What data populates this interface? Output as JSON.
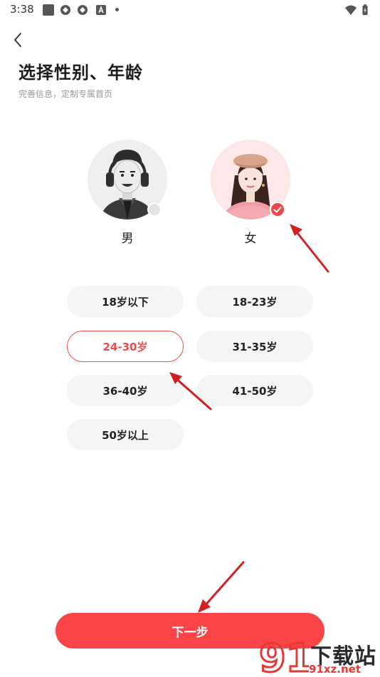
{
  "status_bar": {
    "time": "3:38"
  },
  "header": {
    "title": "选择性别、年龄",
    "subtitle": "完善信息，定制专属首页"
  },
  "gender": {
    "options": [
      {
        "label": "男",
        "selected": false
      },
      {
        "label": "女",
        "selected": true
      }
    ]
  },
  "age": {
    "options": [
      {
        "label": "18岁以下",
        "selected": false
      },
      {
        "label": "18-23岁",
        "selected": false
      },
      {
        "label": "24-30岁",
        "selected": true
      },
      {
        "label": "31-35岁",
        "selected": false
      },
      {
        "label": "36-40岁",
        "selected": false
      },
      {
        "label": "41-50岁",
        "selected": false
      },
      {
        "label": "50岁以上",
        "selected": false
      }
    ]
  },
  "next_button": {
    "label": "下一步"
  },
  "watermark": {
    "brand": "下载站",
    "site": "91xz.net",
    "logo_text": "91"
  },
  "colors": {
    "accent": "#fb4447",
    "selected_border": "#f04a4a",
    "option_bg": "#f5f5f5",
    "annotation_arrow": "#d21f1f"
  }
}
